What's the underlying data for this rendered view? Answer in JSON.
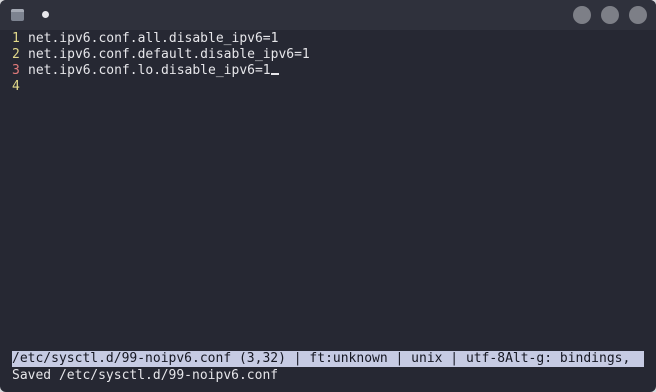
{
  "editor": {
    "lines": [
      {
        "number": "1",
        "text": "net.ipv6.conf.all.disable_ipv6=1"
      },
      {
        "number": "2",
        "text": "net.ipv6.conf.default.disable_ipv6=1"
      },
      {
        "number": "3",
        "text": "net.ipv6.conf.lo.disable_ipv6=1"
      },
      {
        "number": "4",
        "text": ""
      }
    ]
  },
  "statusline": {
    "text": "/etc/sysctl.d/99-noipv6.conf (3,32) | ft:unknown | unix | utf-8Alt-g: bindings,"
  },
  "message": {
    "text": "Saved /etc/sysctl.d/99-noipv6.conf"
  },
  "colors": {
    "background": "#262833",
    "line_number": "#e2d98a",
    "current_line_number": "#e27b7b",
    "statusline_bg": "#c6cbe3"
  }
}
